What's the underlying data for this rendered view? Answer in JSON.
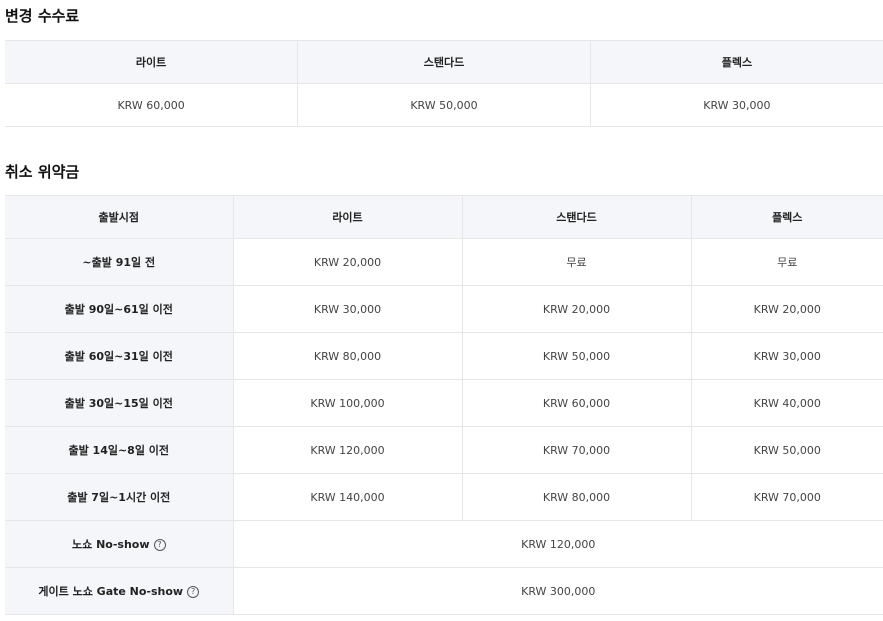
{
  "change_fee": {
    "title": "변경 수수료",
    "headers": [
      "라이트",
      "스탠다드",
      "플렉스"
    ],
    "values": [
      "KRW 60,000",
      "KRW 50,000",
      "KRW 30,000"
    ]
  },
  "cancel_fee": {
    "title": "취소 위약금",
    "headers": [
      "출발시점",
      "라이트",
      "스탠다드",
      "플렉스"
    ],
    "rows": [
      {
        "label": "~출발 91일 전",
        "lite": "KRW 20,000",
        "standard": "무료",
        "flex": "무료"
      },
      {
        "label": "출발 90일~61일 이전",
        "lite": "KRW 30,000",
        "standard": "KRW 20,000",
        "flex": "KRW 20,000"
      },
      {
        "label": "출발 60일~31일 이전",
        "lite": "KRW 80,000",
        "standard": "KRW 50,000",
        "flex": "KRW 30,000"
      },
      {
        "label": "출발 30일~15일 이전",
        "lite": "KRW 100,000",
        "standard": "KRW 60,000",
        "flex": "KRW 40,000"
      },
      {
        "label": "출발 14일~8일 이전",
        "lite": "KRW 120,000",
        "standard": "KRW 70,000",
        "flex": "KRW 50,000"
      },
      {
        "label": "출발 7일~1시간 이전",
        "lite": "KRW 140,000",
        "standard": "KRW 80,000",
        "flex": "KRW 70,000"
      }
    ],
    "noshow": {
      "label": "노쇼 No-show",
      "value": "KRW 120,000"
    },
    "gate_noshow": {
      "label": "게이트 노쇼 Gate No-show",
      "value": "KRW 300,000"
    },
    "help_icon": "question-circle-icon",
    "help_glyph": "?"
  }
}
